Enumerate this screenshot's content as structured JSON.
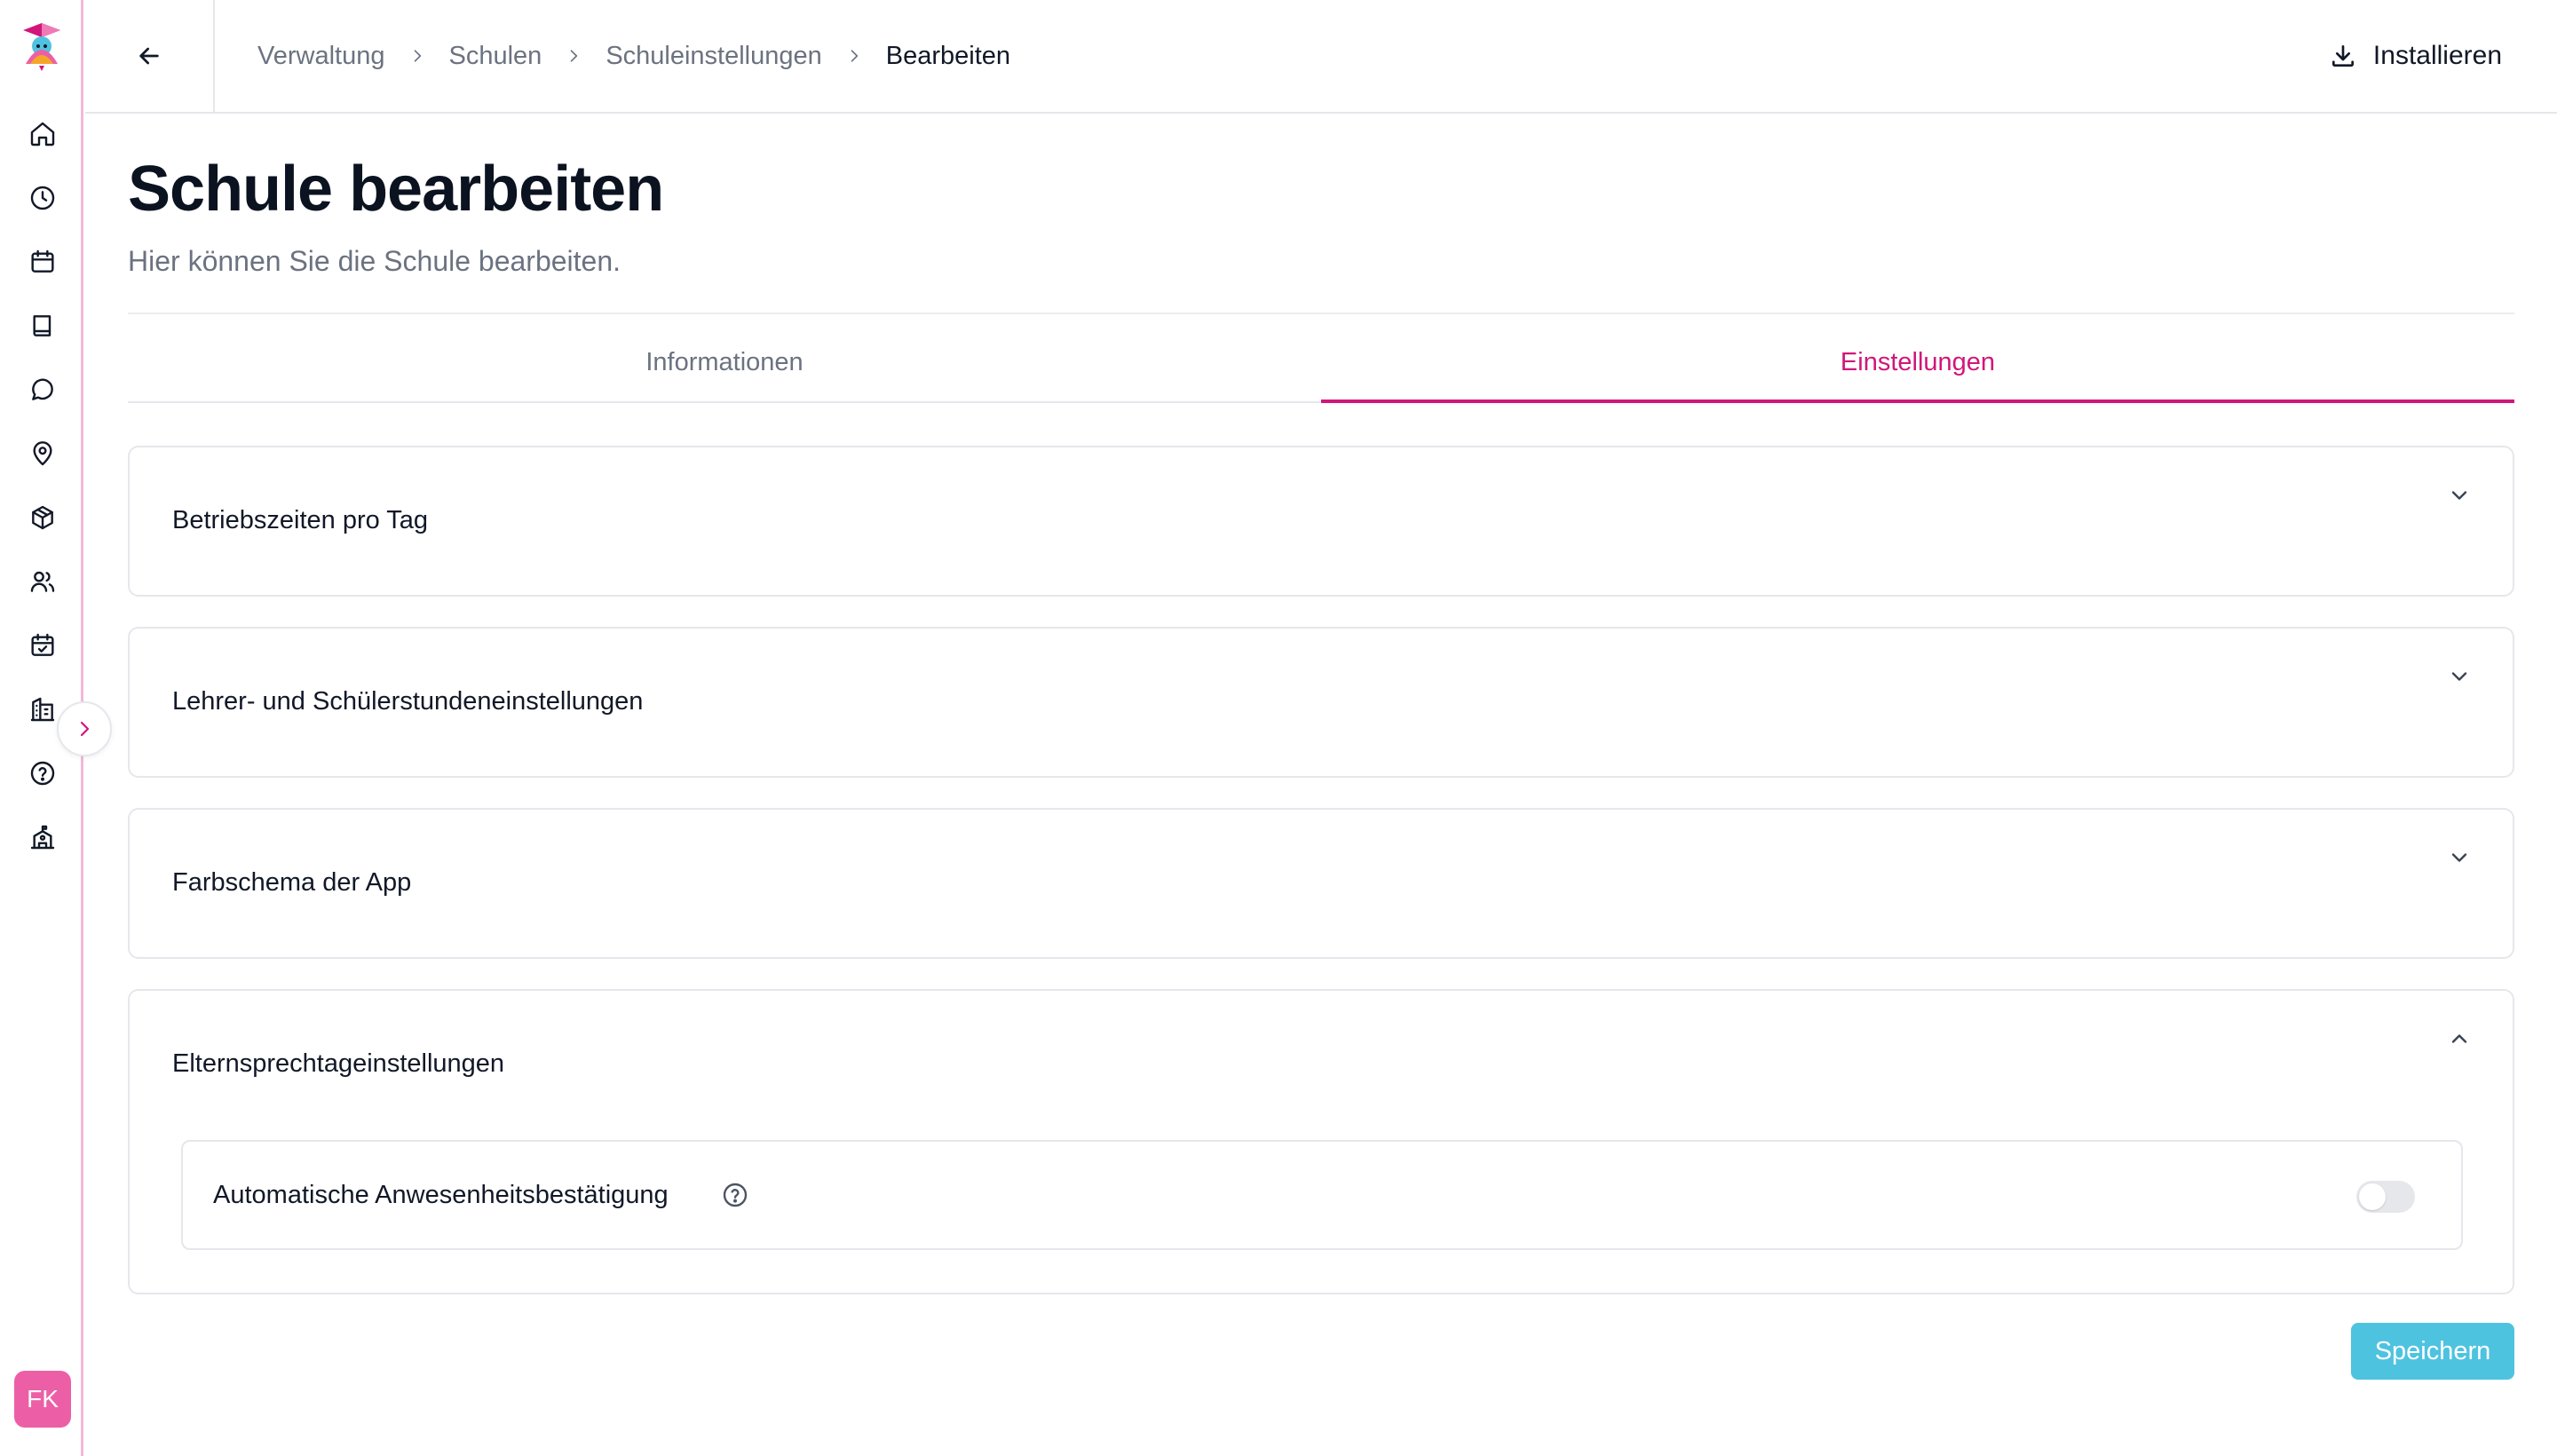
{
  "colors": {
    "accent": "#d1167a",
    "sidebar_border": "#f4b8d8",
    "avatar_bg": "#ec5fa6",
    "save_button_bg": "#4ec3e0"
  },
  "sidebar": {
    "items": [
      {
        "icon": "home-icon"
      },
      {
        "icon": "clock-icon"
      },
      {
        "icon": "calendar-icon"
      },
      {
        "icon": "book-icon"
      },
      {
        "icon": "chat-icon"
      },
      {
        "icon": "location-pin-icon"
      },
      {
        "icon": "package-icon"
      },
      {
        "icon": "users-icon"
      },
      {
        "icon": "calendar-check-icon"
      },
      {
        "icon": "building-icon"
      },
      {
        "icon": "help-circle-icon"
      },
      {
        "icon": "school-icon"
      }
    ],
    "user_initials": "FK"
  },
  "topbar": {
    "breadcrumbs": [
      "Verwaltung",
      "Schulen",
      "Schuleinstellungen",
      "Bearbeiten"
    ],
    "install_label": "Installieren"
  },
  "page": {
    "title": "Schule bearbeiten",
    "subtitle": "Hier können Sie die Schule bearbeiten."
  },
  "tabs": [
    {
      "label": "Informationen",
      "active": false
    },
    {
      "label": "Einstellungen",
      "active": true
    }
  ],
  "sections": [
    {
      "title": "Betriebszeiten pro Tag",
      "expanded": false
    },
    {
      "title": "Lehrer- und Schülerstundeneinstellungen",
      "expanded": false
    },
    {
      "title": "Farbschema der App",
      "expanded": false
    },
    {
      "title": "Elternsprechtageinstellungen",
      "expanded": true,
      "settings": [
        {
          "label": "Automatische Anwesenheitsbestätigung",
          "enabled": false
        }
      ]
    }
  ],
  "actions": {
    "save_label": "Speichern"
  }
}
